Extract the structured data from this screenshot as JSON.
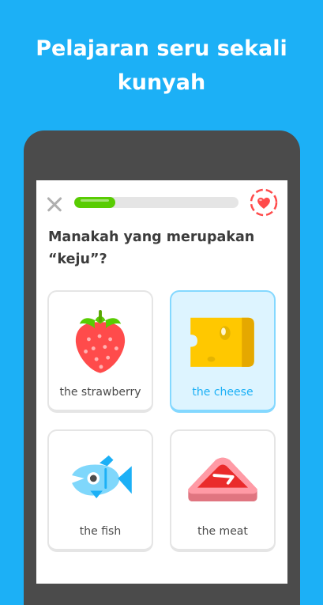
{
  "headline": {
    "line1": "Pelajaran seru sekali",
    "line2": "kunyah"
  },
  "lesson": {
    "progress": 0.25,
    "question_line1": "Manakah yang merupakan",
    "question_line2": "“keju”?"
  },
  "options": [
    {
      "label": "the strawberry",
      "icon": "strawberry-icon",
      "selected": false
    },
    {
      "label": "the cheese",
      "icon": "cheese-icon",
      "selected": true
    },
    {
      "label": "the fish",
      "icon": "fish-icon",
      "selected": false
    },
    {
      "label": "the meat",
      "icon": "meat-icon",
      "selected": false
    }
  ],
  "colors": {
    "background": "#1cb0f6",
    "progress": "#58cc02",
    "selected_border": "#84d8ff",
    "selected_fill": "#ddf4ff",
    "heart": "#ff4b4b"
  }
}
